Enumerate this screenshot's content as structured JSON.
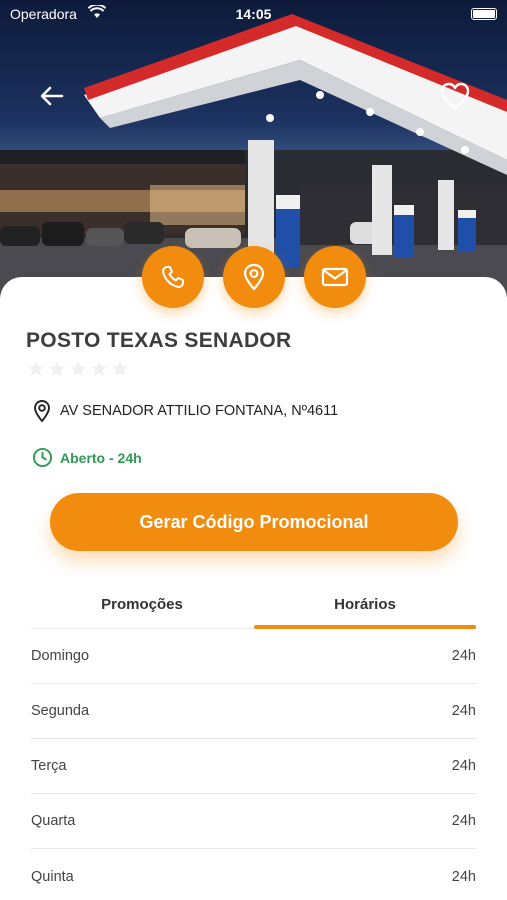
{
  "status_bar": {
    "carrier": "Operadora",
    "time": "14:05"
  },
  "station": {
    "name": "POSTO TEXAS SENADOR",
    "rating": 0,
    "rating_max": 5,
    "address": "AV SENADOR ATTILIO FONTANA, Nº4611",
    "open_status": "Aberto - 24h"
  },
  "actions": {
    "promo_button": "Gerar Código Promocional"
  },
  "tabs": [
    {
      "label": "Promoções",
      "active": false
    },
    {
      "label": "Horários",
      "active": true
    }
  ],
  "hours": [
    {
      "day": "Domingo",
      "value": "24h"
    },
    {
      "day": "Segunda",
      "value": "24h"
    },
    {
      "day": "Terça",
      "value": "24h"
    },
    {
      "day": "Quarta",
      "value": "24h"
    },
    {
      "day": "Quinta",
      "value": "24h"
    }
  ],
  "colors": {
    "accent": "#f28c0f",
    "open_green": "#2e9a55",
    "title": "#3d3d3d"
  },
  "icons": [
    "back-arrow-icon",
    "heart-icon",
    "phone-icon",
    "location-pin-icon",
    "mail-icon",
    "clock-icon",
    "star-icon"
  ]
}
